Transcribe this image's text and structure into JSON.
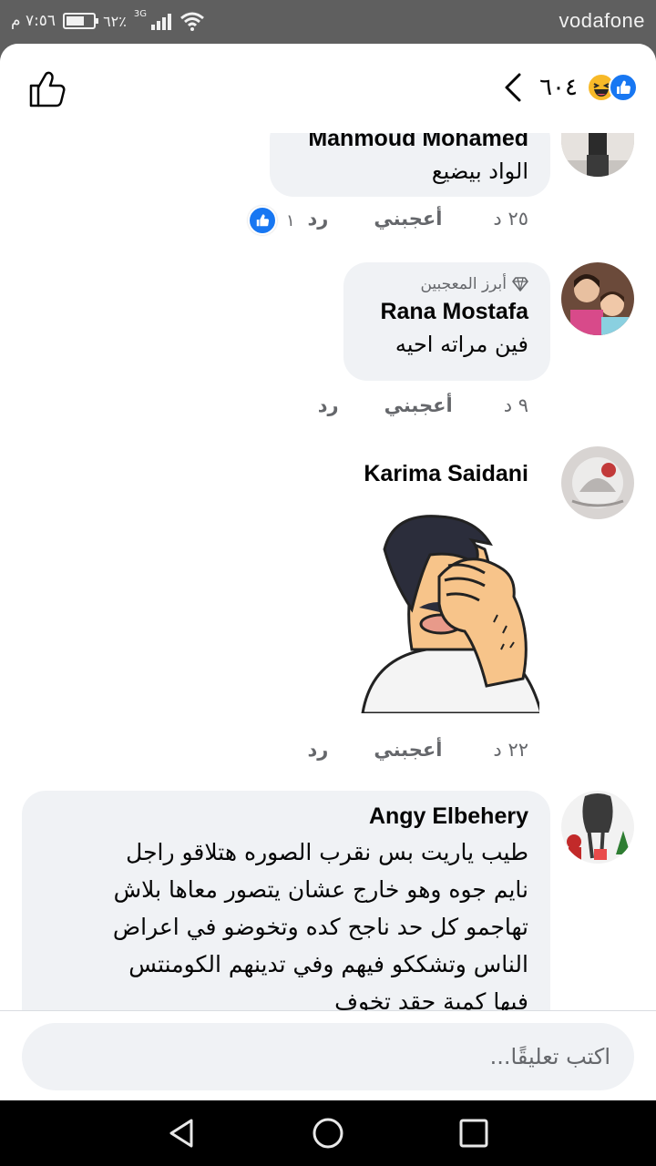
{
  "status_bar": {
    "carrier": "vodafone",
    "time": "٧:٥٦ م",
    "battery_pct": "٦٢٪",
    "network": "3G"
  },
  "header": {
    "reaction_count": "٦٠٤",
    "reaction_icons": [
      "like-icon",
      "haha-icon"
    ],
    "like_button_icon": "thumbs-up-outline-icon",
    "back_icon": "chevron-left-icon"
  },
  "comments": [
    {
      "author": "Mahmoud Mohamed",
      "text": "الواد بيضيع",
      "age": "٢٥ د",
      "like_label": "أعجبني",
      "reply_label": "رد",
      "like_count": "١"
    },
    {
      "badge": "أبرز المعجبين",
      "author": "Rana Mostafa",
      "text": "فين مراته احيه",
      "age": "٩ د",
      "like_label": "أعجبني",
      "reply_label": "رد"
    },
    {
      "author": "Karima Saidani",
      "sticker": "facepalm-sticker",
      "age": "٢٢ د",
      "like_label": "أعجبني",
      "reply_label": "رد"
    },
    {
      "author": "Angy Elbehery",
      "lines": [
        "طيب ياريت بس نقرب الصوره هتلاقو راجل",
        "نايم جوه وهو خارج عشان يتصور معاها بلاش",
        "تهاجمو كل حد ناجح كده وتخوضو في اعراض",
        "الناس وتشككو فيهم وفي تدينهم الكومنتس",
        "فيها كمية حقد تخوف"
      ]
    }
  ],
  "composer": {
    "placeholder": "اكتب تعليقًا..."
  },
  "colors": {
    "accent": "#1877f2",
    "bubble": "#f0f2f5",
    "muted_text": "#65676b",
    "status_bar": "#5f5f5f"
  }
}
